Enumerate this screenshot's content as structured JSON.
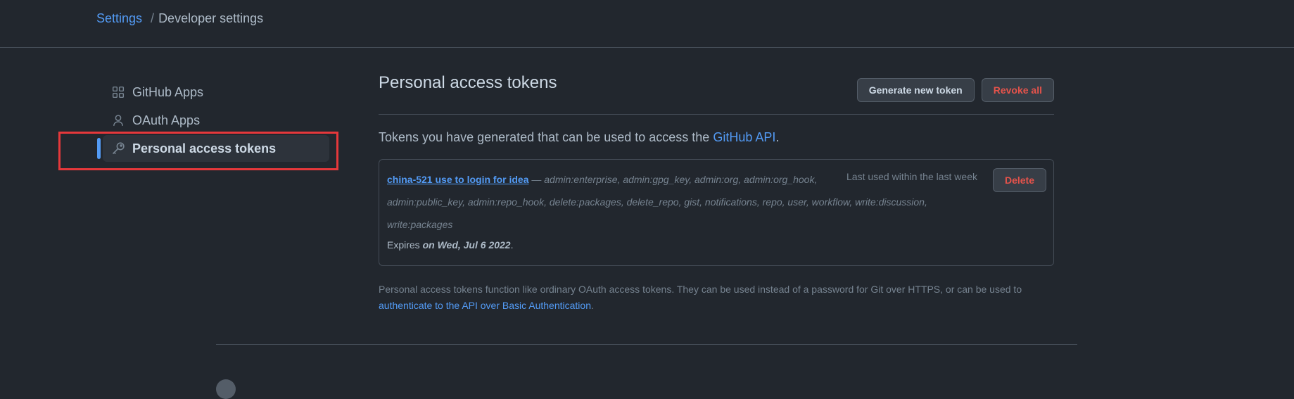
{
  "breadcrumb": {
    "root": "Settings",
    "separator": "/",
    "current": "Developer settings"
  },
  "sidebar": {
    "items": [
      {
        "label": "GitHub Apps",
        "icon": "apps-grid-icon"
      },
      {
        "label": "OAuth Apps",
        "icon": "person-icon"
      },
      {
        "label": "Personal access tokens",
        "icon": "key-icon",
        "selected": true
      }
    ]
  },
  "main": {
    "title": "Personal access tokens",
    "generate_label": "Generate new token",
    "revoke_label": "Revoke all",
    "intro_text": "Tokens you have generated that can be used to access the ",
    "intro_link": "GitHub API",
    "intro_end": "."
  },
  "token": {
    "name": "china-521 use to login for idea",
    "dash": " — ",
    "scopes_line1": "admin:enterprise, admin:gpg_key, admin:org, admin:org_hook,",
    "scopes_line2": "admin:public_key, admin:repo_hook, delete:packages, delete_repo, gist, notifications, repo, user, workflow, write:discussion,",
    "scopes_line3": "write:packages",
    "last_used": "Last used within the last week",
    "delete_label": "Delete",
    "expires_prefix": "Expires ",
    "expires_date": "on Wed, Jul 6 2022",
    "expires_end": "."
  },
  "footnote": {
    "text": "Personal access tokens function like ordinary OAuth access tokens. They can be used instead of a password for Git over HTTPS, or can be used to",
    "link": "authenticate to the API over Basic Authentication",
    "end": "."
  },
  "colors": {
    "background": "#22272e",
    "accent": "#539bf5",
    "danger": "#e5534b",
    "highlight": "#e5383b"
  }
}
